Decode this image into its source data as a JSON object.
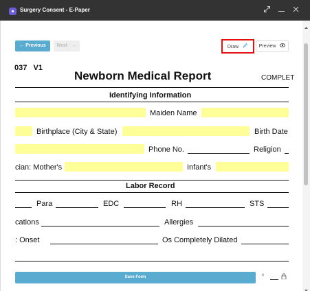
{
  "window": {
    "title": "Surgery Consent - E-Paper",
    "accent": "#6a5fd8"
  },
  "toolbar": {
    "previous_label": "Previous",
    "next_label": "Next",
    "draw_label": "Draw",
    "preview_label": "Preview",
    "highlight_color": "#e40f0f",
    "primary_color": "#5aabd0",
    "previous_icon": "arrow-left-icon",
    "next_icon": "arrow-right-icon",
    "draw_icon": "pencil-icon",
    "preview_icon": "eye-icon"
  },
  "document": {
    "code": "037",
    "version": "V1",
    "title": "Newborn Medical Report",
    "status_partial": "COMPLET",
    "field_color": "#ffff99",
    "sections": {
      "identifying": "Identifying Information",
      "labor": "Labor Record"
    },
    "labels": {
      "maiden_name": "Maiden Name",
      "birthplace": "Birthplace (City & State)",
      "birth_date": "Birth Date",
      "phone": "Phone No.",
      "religion": "Religion",
      "physician": "cian: Mother's",
      "infant": "Infant's",
      "para": "Para",
      "edc": "EDC",
      "rh": "RH",
      "sts": "STS",
      "complications": "cations",
      "allergies": "Allergies",
      "onset": ": Onset",
      "os_dilated": "Os Completely Dilated"
    }
  },
  "footer": {
    "save_label": "Save Form",
    "x_label": "x",
    "lock_icon": "lock-icon"
  }
}
